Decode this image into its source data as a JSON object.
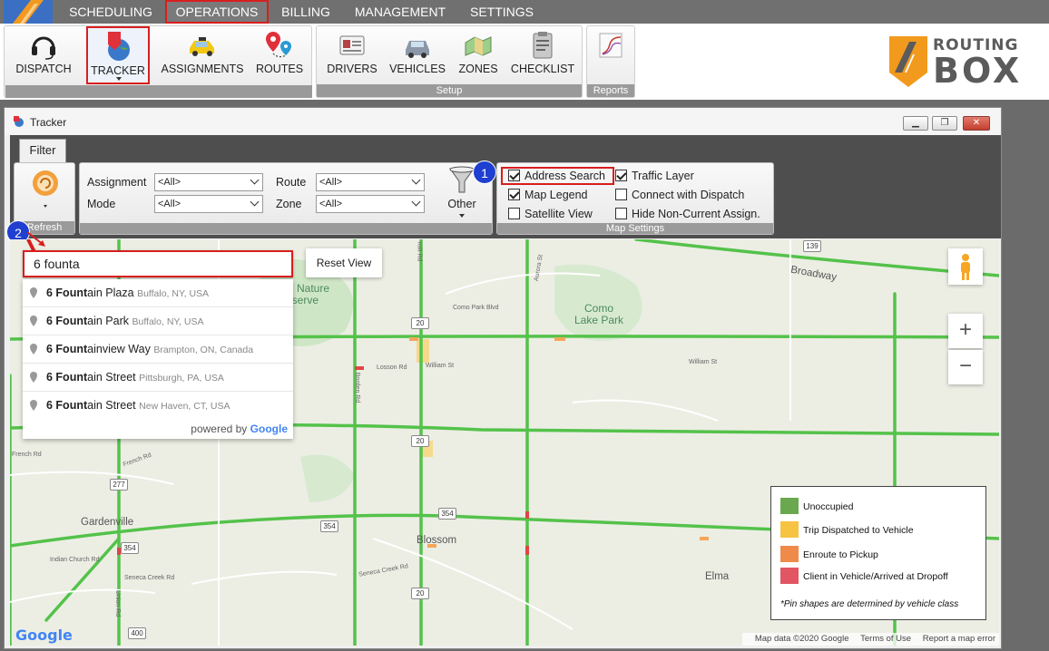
{
  "menu": {
    "items": [
      "SCHEDULING",
      "OPERATIONS",
      "BILLING",
      "MANAGEMENT",
      "SETTINGS"
    ],
    "active": "OPERATIONS"
  },
  "ribbon": {
    "operations_buttons": [
      {
        "label": "DISPATCH",
        "icon": "headset-icon"
      },
      {
        "label": "TRACKER",
        "icon": "globe-pin-icon"
      },
      {
        "label": "ASSIGNMENTS",
        "icon": "taxi-icon"
      },
      {
        "label": "ROUTES",
        "icon": "route-pins-icon"
      }
    ],
    "setup_buttons": [
      {
        "label": "DRIVERS",
        "icon": "id-card-icon"
      },
      {
        "label": "VEHICLES",
        "icon": "car-icon"
      },
      {
        "label": "ZONES",
        "icon": "map-zones-icon"
      },
      {
        "label": "CHECKLIST",
        "icon": "clipboard-icon"
      }
    ],
    "setup_label": "Setup",
    "reports_label": "Reports",
    "brand_line1": "ROUTING",
    "brand_line2": "BOX"
  },
  "tracker": {
    "title": "Tracker",
    "filter_tab": "Filter",
    "refresh_label": "Refresh",
    "assignment_label": "Assignment",
    "assignment_value": "<All>",
    "route_label": "Route",
    "route_value": "<All>",
    "mode_label": "Mode",
    "mode_value": "<All>",
    "zone_label": "Zone",
    "zone_value": "<All>",
    "other_label": "Other",
    "map_settings_label": "Map Settings",
    "checkboxes": {
      "address_search": {
        "label": "Address Search",
        "checked": true
      },
      "traffic_layer": {
        "label": "Traffic Layer",
        "checked": true
      },
      "map_legend": {
        "label": "Map Legend",
        "checked": true
      },
      "connect_dispatch": {
        "label": "Connect with Dispatch",
        "checked": false
      },
      "satellite_view": {
        "label": "Satellite View",
        "checked": false
      },
      "hide_noncurrent": {
        "label": "Hide Non-Current Assign.",
        "checked": false
      }
    },
    "callout_1": "1",
    "callout_2": "2"
  },
  "map": {
    "search_value": "6 founta",
    "reset_view_label": "Reset View",
    "suggestions": [
      {
        "match": "6 Fount",
        "rest": "ain Plaza",
        "secondary": "Buffalo, NY, USA"
      },
      {
        "match": "6 Fount",
        "rest": "ain Park",
        "secondary": "Buffalo, NY, USA"
      },
      {
        "match": "6 Fount",
        "rest": "ainview Way",
        "secondary": "Brampton, ON, Canada"
      },
      {
        "match": "6 Fount",
        "rest": "ain Street",
        "secondary": "Pittsburgh, PA, USA"
      },
      {
        "match": "6 Fount",
        "rest": "ain Street",
        "secondary": "New Haven, CT, USA"
      }
    ],
    "powered_by": "powered by",
    "powered_brand": "Google",
    "zoom_in": "+",
    "zoom_out": "−",
    "legend": {
      "items": [
        {
          "label": "Unoccupied",
          "color": "#6aa84f"
        },
        {
          "label": "Trip Dispatched to Vehicle",
          "color": "#f6c342"
        },
        {
          "label": "Enroute to Pickup",
          "color": "#f08a4b"
        },
        {
          "label": "Client in Vehicle/Arrived at Dropoff",
          "color": "#e25563"
        }
      ],
      "note": "*Pin shapes are determined by vehicle class"
    },
    "attribution": [
      "Map data ©2020 Google",
      "Terms of Use",
      "Report a map error"
    ],
    "google_logo": "Google",
    "places": {
      "gardenville": "Gardenville",
      "blossom": "Blossom",
      "elma": "Elma",
      "como_park": "Como\nLake Park",
      "nature": "ds Nature\nreserve",
      "broadway": "Broadway"
    },
    "streets": {
      "como_park_blvd": "Como Park Blvd",
      "losson": "Losson Rd",
      "william1": "William St",
      "william2": "William St",
      "french1": "French Rd",
      "french2": "French Rd",
      "indian_church": "Indian Church Rd",
      "seneca1": "Seneca Creek Rd",
      "seneca2": "Seneca Creek Rd",
      "borden": "Borden Rd",
      "aurora": "Aurora St",
      "union": "Union Rd",
      "transit": "nsit Rd"
    },
    "shields": {
      "s139": "139",
      "s20a": "20",
      "s20b": "20",
      "s20c": "20",
      "s277": "277",
      "s354a": "354",
      "s354b": "354",
      "s354c": "354",
      "s400": "400"
    }
  }
}
